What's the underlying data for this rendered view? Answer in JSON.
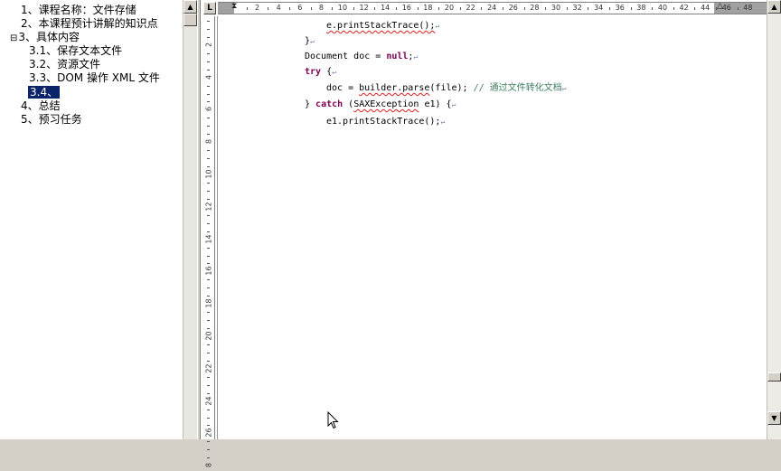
{
  "outline": {
    "items": [
      {
        "label": "1、课程名称：文件存储",
        "expander": ""
      },
      {
        "label": "2、本课程预计讲解的知识点",
        "expander": ""
      },
      {
        "label": "3、具体内容",
        "expander": "⊟"
      },
      {
        "label": "3.1、保存文本文件",
        "expander": ""
      },
      {
        "label": "3.2、资源文件",
        "expander": ""
      },
      {
        "label": "3.3、DOM 操作 XML 文件",
        "expander": ""
      },
      {
        "label": "3.4、",
        "expander": ""
      },
      {
        "label": "4、总结",
        "expander": ""
      },
      {
        "label": "5、预习任务",
        "expander": ""
      }
    ]
  },
  "ruler": {
    "tab_symbol": "L",
    "h_labels": [
      "2",
      "4",
      "6",
      "8",
      "10",
      "12",
      "14",
      "16",
      "18",
      "20",
      "22",
      "24",
      "26",
      "28",
      "30",
      "32",
      "34",
      "36",
      "38",
      "40",
      "42",
      "44",
      "46",
      "48"
    ],
    "v_labels": [
      "2",
      "4",
      "6",
      "8",
      "10",
      "12",
      "14",
      "16",
      "18",
      "20",
      "22",
      "24",
      "26",
      "8"
    ]
  },
  "code": {
    "pilcrow": "↵",
    "line1": "e.printStackTrace();",
    "line2": "}",
    "line3_a": "Document doc = ",
    "line3_kw": "null",
    "line3_b": ";",
    "line4_kw": "try",
    "line4_b": " {",
    "line5_a": "doc = ",
    "line5_sq": "builder.parse",
    "line5_b": "(file); ",
    "line5_cm": "// 通过文件转化文档",
    "line6_a": "} ",
    "line6_kw": "catch",
    "line6_b": " (",
    "line6_sq": "SAXException",
    "line6_c": " e1) {",
    "line7": "e1.printStackTrace();"
  },
  "scroll": {
    "up": "▲",
    "down": "▼"
  },
  "colors": {
    "keyword": "#7f0055",
    "comment": "#3f7f5f",
    "selection": "#0a246a"
  }
}
